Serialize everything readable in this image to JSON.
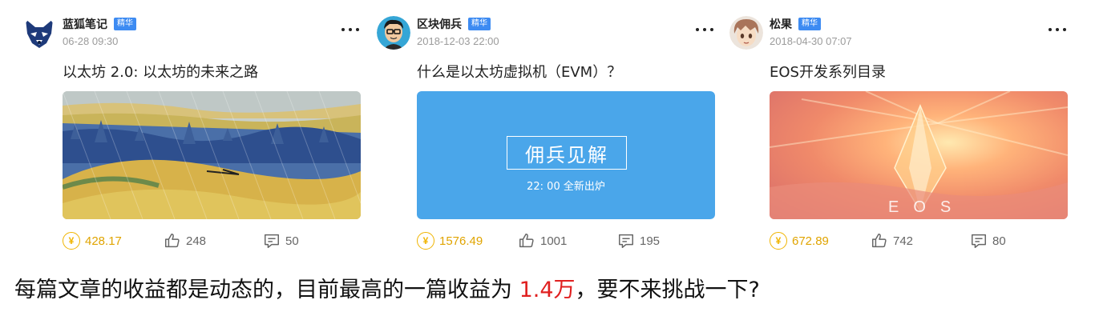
{
  "cards": [
    {
      "author": "蓝狐笔记",
      "badge": "精华",
      "time": "06-28 09:30",
      "title": "以太坊 2.0: 以太坊的未来之路",
      "earnings": "428.17",
      "likes": "248",
      "comments": "50",
      "avatar_icon": "fox-avatar-icon",
      "cover": "painting-landscape-cover"
    },
    {
      "author": "区块佣兵",
      "badge": "精华",
      "time": "2018-12-03 22:00",
      "title": "什么是以太坊虚拟机（EVM）？",
      "earnings": "1576.49",
      "likes": "1001",
      "comments": "195",
      "avatar_icon": "cartoon-man-avatar-icon",
      "cover_title": "佣兵见解",
      "cover_subtitle": "22: 00  全新出炉"
    },
    {
      "author": "松果",
      "badge": "精华",
      "time": "2018-04-30 07:07",
      "title": "EOS开发系列目录",
      "earnings": "672.89",
      "likes": "742",
      "comments": "80",
      "avatar_icon": "anime-avatar-icon",
      "cover_text": "EOS"
    }
  ],
  "icons": {
    "coin": "¥",
    "more": "more-dots-icon",
    "like": "thumbs-up-icon",
    "comment": "comment-icon"
  },
  "footer": {
    "text_before": "每篇文章的收益都是动态的，目前最高的一篇收益为 ",
    "highlight": "1.4万",
    "text_after": "，要不来挑战一下?"
  },
  "colors": {
    "badge": "#3d8bf2",
    "earnings": "#e0a400",
    "highlight": "#e02020",
    "evm_cover": "#4aa6ea"
  }
}
